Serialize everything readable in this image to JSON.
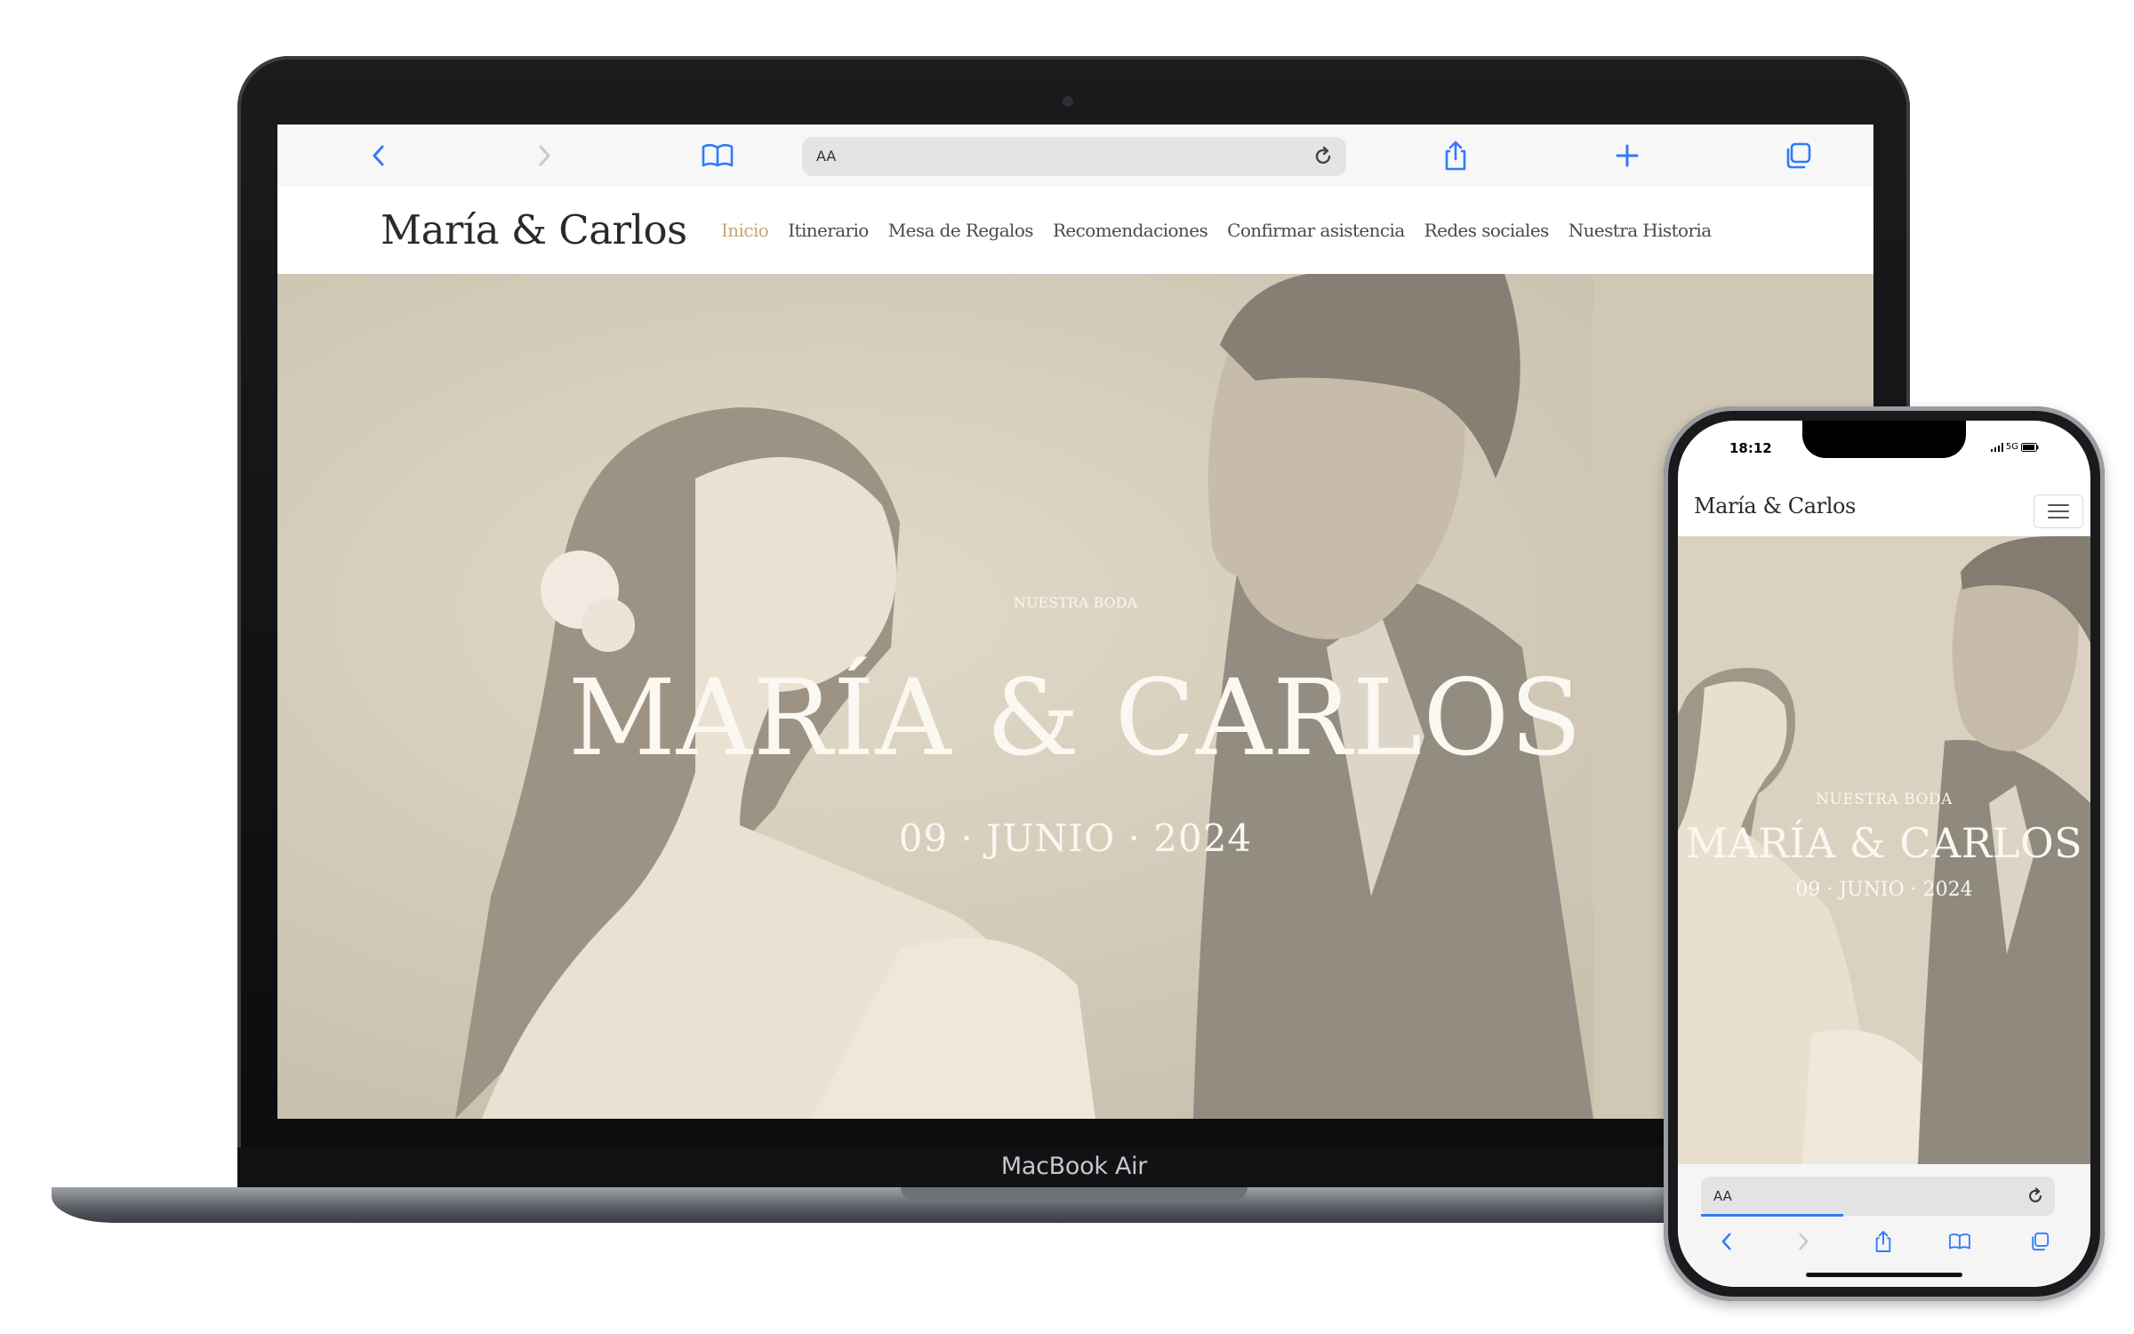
{
  "laptop": {
    "label": "MacBook Air",
    "browser": {
      "url_text": "AA",
      "icons": [
        "back-icon",
        "forward-icon",
        "bookmarks-icon",
        "reload-icon",
        "share-icon",
        "new-tab-icon",
        "tabs-icon"
      ]
    },
    "site": {
      "logo": "María & Carlos",
      "nav": [
        {
          "label": "Inicio",
          "active": true
        },
        {
          "label": "Itinerario",
          "active": false
        },
        {
          "label": "Mesa de Regalos",
          "active": false
        },
        {
          "label": "Recomendaciones",
          "active": false
        },
        {
          "label": "Confirmar asistencia",
          "active": false
        },
        {
          "label": "Redes sociales",
          "active": false
        },
        {
          "label": "Nuestra Historia",
          "active": false
        }
      ],
      "hero": {
        "kicker": "NUESTRA BODA",
        "title": "MARÍA & CARLOS",
        "date": "09 · JUNIO · 2024"
      }
    }
  },
  "phone": {
    "status_time": "18:12",
    "status_network": "5G",
    "site": {
      "logo": "María & Carlos",
      "menu_icon": "hamburger-menu-icon",
      "hero": {
        "kicker": "NUESTRA BODA",
        "title": "MARÍA & CARLOS",
        "date": "09 · JUNIO · 2024"
      }
    },
    "browser": {
      "url_text": "AA",
      "icons": [
        "back-icon",
        "forward-icon",
        "share-icon",
        "bookmarks-icon",
        "tabs-icon"
      ]
    }
  },
  "colors": {
    "accent_active_nav": "#c9a476",
    "safari_blue": "#2f7cf6",
    "hero_tone": "#c9c0ad",
    "hero_text": "#fbf8f1"
  }
}
